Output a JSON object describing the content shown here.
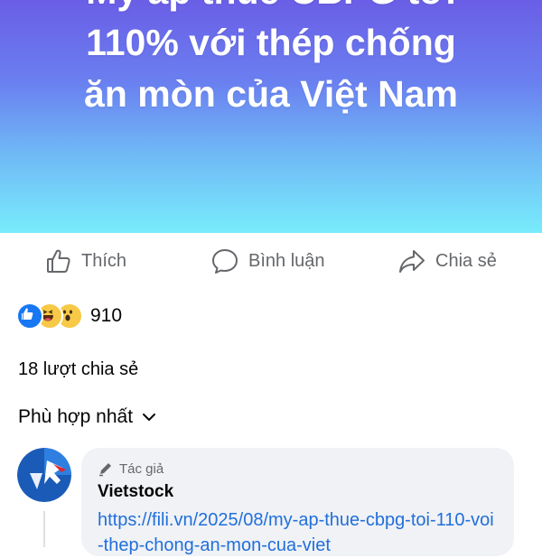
{
  "post": {
    "banner_lines": [
      "Mỹ áp thuế CBPG tới",
      "110% với thép chống",
      "ăn mòn của Việt Nam"
    ]
  },
  "actions": {
    "like_label": "Thích",
    "comment_label": "Bình luận",
    "share_label": "Chia sẻ"
  },
  "reactions": {
    "icons": [
      "like-icon",
      "haha-icon",
      "wow-icon"
    ],
    "count": "910"
  },
  "shares": {
    "label": "18 lượt chia sẻ"
  },
  "comments": {
    "sort_label": "Phù hợp nhất",
    "items": [
      {
        "author_tag": "Tác giả",
        "author": "Vietstock",
        "text": "https://fili.vn/2025/08/my-ap-thue-cbpg-toi-110-voi-thep-chong-an-mon-cua-viet"
      }
    ]
  },
  "colors": {
    "accent": "#1877f2",
    "link": "#216fdb",
    "muted": "#65676b"
  }
}
